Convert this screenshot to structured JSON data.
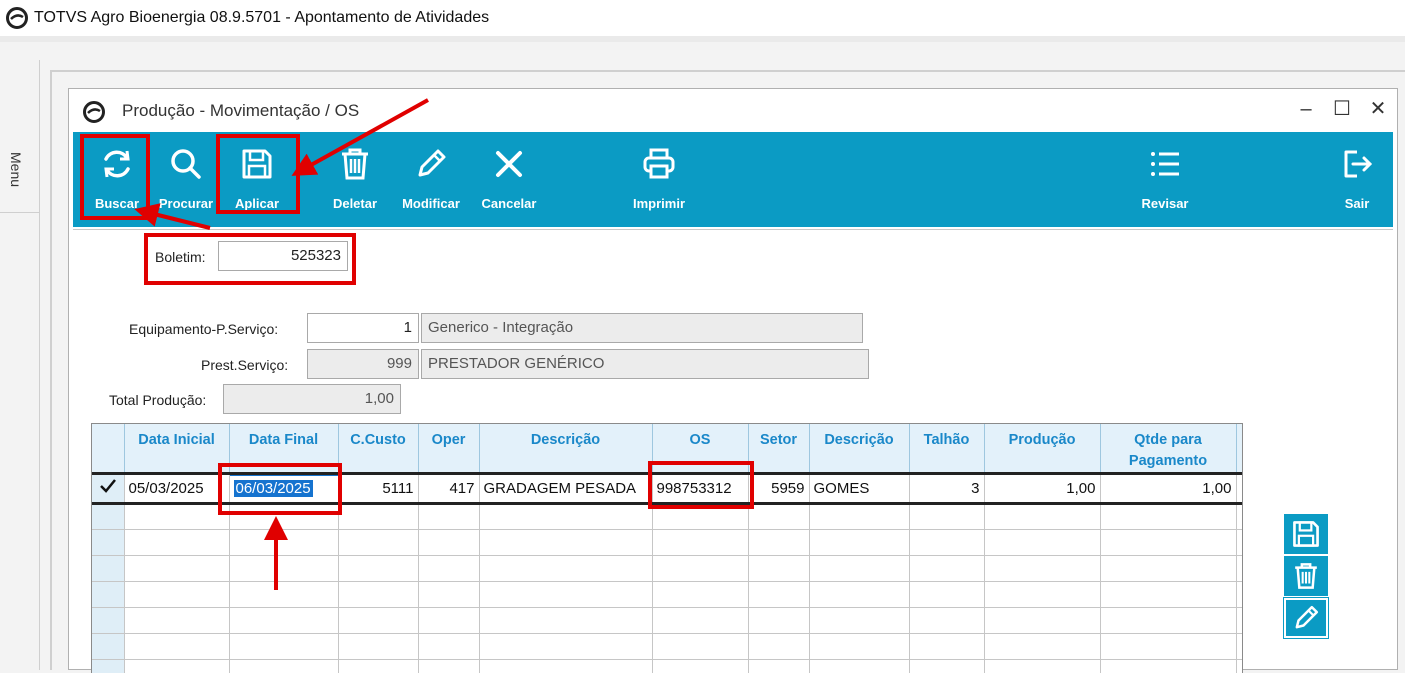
{
  "app": {
    "title": "TOTVS Agro Bioenergia 08.9.5701 - Apontamento de Atividades",
    "icon": "totvs-logo-icon"
  },
  "menu": {
    "label": "Menu"
  },
  "window": {
    "title": "Produção - Movimentação / OS",
    "controls": [
      "minimize-icon",
      "maximize-icon",
      "close-icon"
    ]
  },
  "toolbar": {
    "buscar": "Buscar",
    "procurar": "Procurar",
    "aplicar": "Aplicar",
    "deletar": "Deletar",
    "modificar": "Modificar",
    "cancelar": "Cancelar",
    "imprimir": "Imprimir",
    "revisar": "Revisar",
    "sair": "Sair",
    "color": "#0b9bc4"
  },
  "form": {
    "boletim_label": "Boletim:",
    "boletim_value": "525323",
    "equipamento_label": "Equipamento-P.Serviço:",
    "equipamento_code": "1",
    "equipamento_desc": "Generico - Integração",
    "prestador_label": "Prest.Serviço:",
    "prestador_code": "999",
    "prestador_desc": "PRESTADOR GENÉRICO",
    "total_label": "Total Produção:",
    "total_value": "1,00"
  },
  "grid": {
    "columns": [
      "Data Inicial",
      "Data Final",
      "C.Custo",
      "Oper",
      "Descrição",
      "OS",
      "Setor",
      "Descrição",
      "Talhão",
      "Produção",
      "Qtde para Pagamento"
    ],
    "rows": [
      {
        "data_inicial": "05/03/2025",
        "data_final": "06/03/2025",
        "c_custo": "5111",
        "oper": "417",
        "descricao": "GRADAGEM PESADA",
        "os": "998753312",
        "setor": "5959",
        "descricao_setor": "GOMES",
        "talhao": "3",
        "producao": "1,00",
        "qtde_pagamento": "1,00"
      }
    ]
  },
  "side_icons": [
    "save-icon",
    "trash-icon",
    "edit-icon"
  ],
  "annotation_color": "#e00000"
}
